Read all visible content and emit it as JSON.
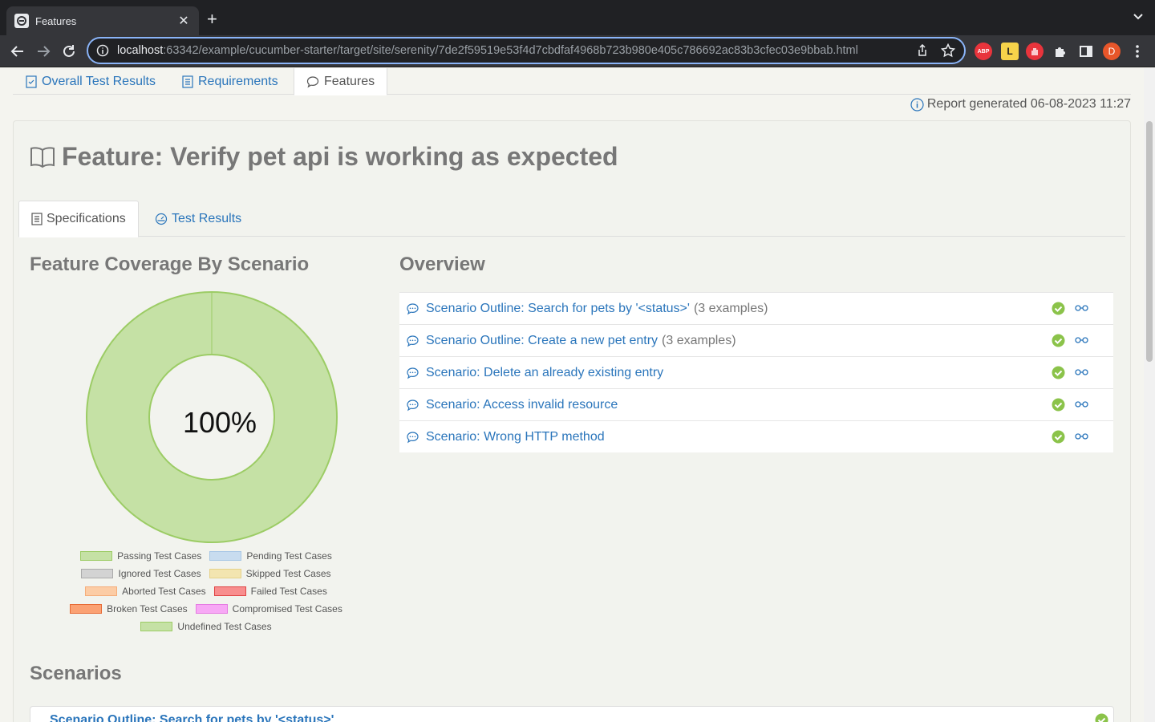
{
  "browser": {
    "tab_title": "Features",
    "url_host": "localhost",
    "url_rest": ":63342/example/cucumber-starter/target/site/serenity/7de2f59519e53f4d7cbdfaf4968b723b980e405c786692ac83b3cfec03e9bbab.html",
    "avatar_letter": "D",
    "ext_abp": "ABP",
    "ext_l": "L"
  },
  "topnav": {
    "items": [
      {
        "label": "Overall Test Results"
      },
      {
        "label": "Requirements"
      },
      {
        "label": "Features"
      }
    ]
  },
  "report_generated": "Report generated 06-08-2023 11:27",
  "feature": {
    "title": "Feature: Verify pet api is working as expected"
  },
  "subtabs": [
    {
      "label": "Specifications"
    },
    {
      "label": "Test Results"
    }
  ],
  "coverage": {
    "heading": "Feature Coverage By Scenario",
    "percent": "100%",
    "pass_fraction": 1.0,
    "legend": [
      {
        "label": "Passing Test Cases",
        "fill": "#c5e1a5",
        "border": "#9ccc65"
      },
      {
        "label": "Pending Test Cases",
        "fill": "#c8dcef",
        "border": "#a9c8e6"
      },
      {
        "label": "Ignored Test Cases",
        "fill": "#d3d3d3",
        "border": "#aaaaaa"
      },
      {
        "label": "Skipped Test Cases",
        "fill": "#f3e5b0",
        "border": "#e6d28a"
      },
      {
        "label": "Aborted Test Cases",
        "fill": "#fccca5",
        "border": "#f5ad7a"
      },
      {
        "label": "Failed Test Cases",
        "fill": "#f88e8e",
        "border": "#e04545"
      },
      {
        "label": "Broken Test Cases",
        "fill": "#fba173",
        "border": "#e66a35"
      },
      {
        "label": "Compromised Test Cases",
        "fill": "#f7a8f5",
        "border": "#e47be1"
      },
      {
        "label": "Undefined Test Cases",
        "fill": "#c5e1a5",
        "border": "#9ccc65"
      }
    ]
  },
  "overview": {
    "heading": "Overview",
    "rows": [
      {
        "name": "Scenario Outline: Search for pets by '<status>'",
        "examples": "(3 examples)"
      },
      {
        "name": "Scenario Outline: Create a new pet entry",
        "examples": "(3 examples)"
      },
      {
        "name": "Scenario: Delete an already existing entry",
        "examples": ""
      },
      {
        "name": "Scenario: Access invalid resource",
        "examples": ""
      },
      {
        "name": "Scenario: Wrong HTTP method",
        "examples": ""
      }
    ]
  },
  "scenarios": {
    "heading": "Scenarios",
    "first": "Scenario Outline: Search for pets by '<status>'"
  },
  "colors": {
    "link": "#2a75bb",
    "pass": "#8bc34a",
    "donut": "#c5e1a5"
  }
}
